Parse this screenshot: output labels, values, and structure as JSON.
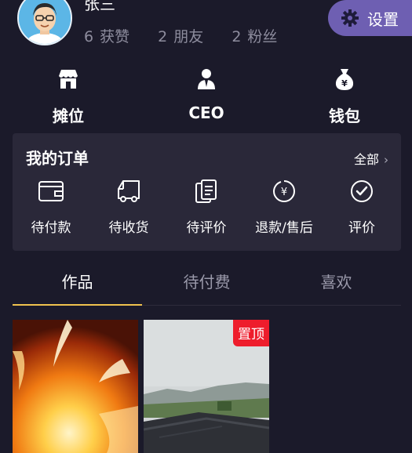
{
  "profile": {
    "username": "张三",
    "stats": [
      {
        "num": "6",
        "label": "获赞"
      },
      {
        "num": "2",
        "label": "朋友"
      },
      {
        "num": "2",
        "label": "粉丝"
      }
    ]
  },
  "settings": {
    "label": "设置"
  },
  "quick_actions": [
    {
      "label": "摊位",
      "icon": "stall-icon"
    },
    {
      "label": "CEO",
      "icon": "ceo-icon"
    },
    {
      "label": "钱包",
      "icon": "money-bag-icon"
    }
  ],
  "orders": {
    "title": "我的订单",
    "all_label": "全部",
    "items": [
      {
        "label": "待付款",
        "icon": "wallet-icon"
      },
      {
        "label": "待收货",
        "icon": "truck-icon"
      },
      {
        "label": "待评价",
        "icon": "document-icon"
      },
      {
        "label": "退款/售后",
        "icon": "refund-icon"
      },
      {
        "label": "评价",
        "icon": "check-circle-icon"
      }
    ]
  },
  "tabs": [
    {
      "label": "作品",
      "active": true
    },
    {
      "label": "待付费",
      "active": false
    },
    {
      "label": "喜欢",
      "active": false
    }
  ],
  "grid": {
    "pin_label": "置顶"
  },
  "colors": {
    "accent": "#f0c24e",
    "settings_bg": "#6e5fb2",
    "pin": "#ee1d2c",
    "bg": "#1b1a2a"
  }
}
